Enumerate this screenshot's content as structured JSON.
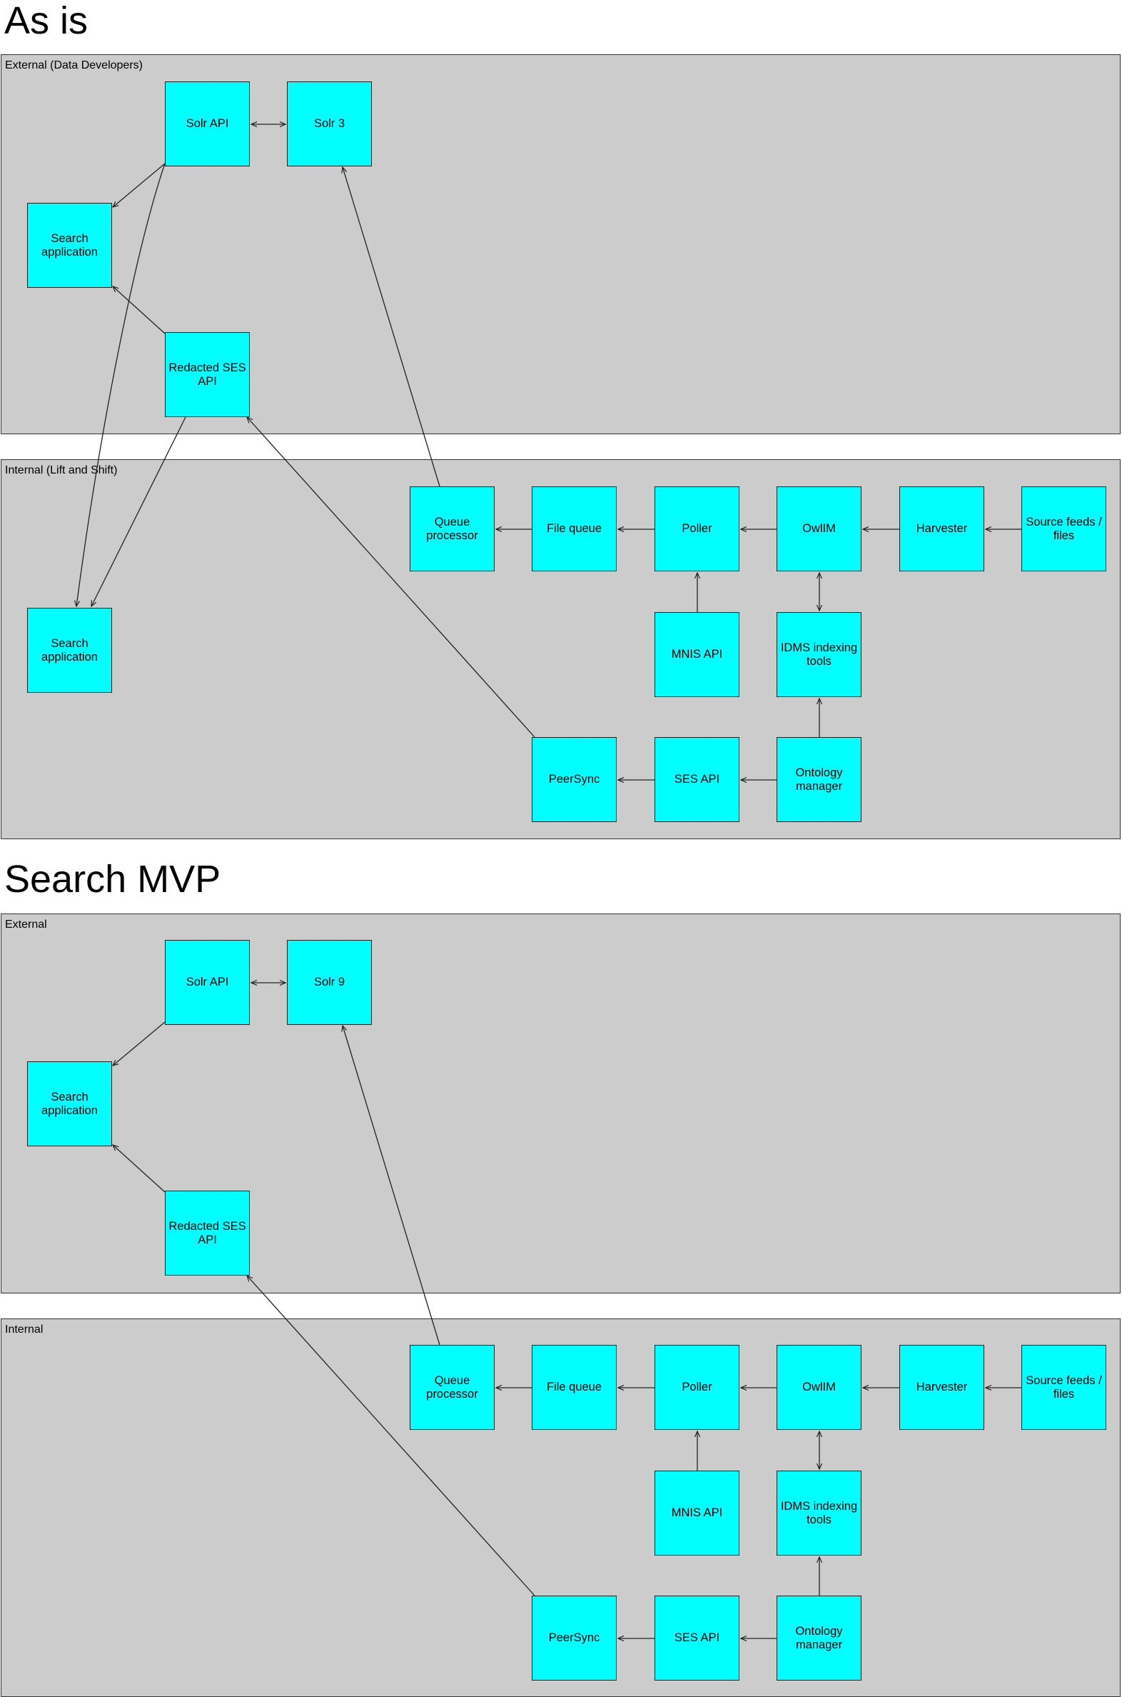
{
  "sections": [
    {
      "heading": "As is",
      "external_label": "External (Data Developers)",
      "internal_label": "Internal (Lift and Shift)",
      "nodes": {
        "solr_api": "Solr API",
        "solr": "Solr 3",
        "search_app_ext": "Search application",
        "redacted_ses_api": "Redacted SES API",
        "search_app_int": "Search application",
        "queue_processor": "Queue processor",
        "file_queue": "File queue",
        "poller": "Poller",
        "owlim": "OwlIM",
        "harvester": "Harvester",
        "source_feeds": "Source feeds / files",
        "mnis_api": "MNIS API",
        "idms_tools": "IDMS indexing tools",
        "peersync": "PeerSync",
        "ses_api": "SES API",
        "ontology_manager": "Ontology manager"
      }
    },
    {
      "heading": "Search MVP",
      "external_label": "External",
      "internal_label": "Internal",
      "nodes": {
        "solr_api": "Solr API",
        "solr": "Solr 9",
        "search_app_ext": "Search application",
        "redacted_ses_api": "Redacted SES API",
        "queue_processor": "Queue processor",
        "file_queue": "File queue",
        "poller": "Poller",
        "owlim": "OwlIM",
        "harvester": "Harvester",
        "source_feeds": "Source feeds / files",
        "mnis_api": "MNIS API",
        "idms_tools": "IDMS indexing tools",
        "peersync": "PeerSync",
        "ses_api": "SES API",
        "ontology_manager": "Ontology manager"
      }
    }
  ],
  "colors": {
    "zone_fill": "#cccccc",
    "node_fill": "#00ffff",
    "border": "#222222"
  }
}
